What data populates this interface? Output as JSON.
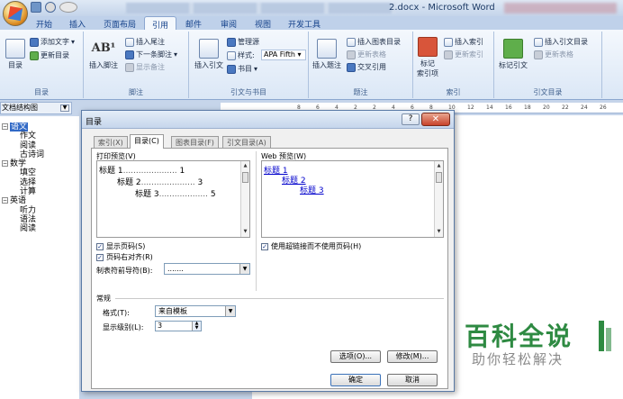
{
  "window": {
    "title": "2.docx - Microsoft Word"
  },
  "ribbon": {
    "tabs": [
      "开始",
      "插入",
      "页面布局",
      "引用",
      "邮件",
      "审阅",
      "视图",
      "开发工具"
    ],
    "active_tab": "引用",
    "groups": {
      "toc": {
        "label": "目录",
        "toc_button": "目录",
        "add_text": "添加文字",
        "update_toc": "更新目录"
      },
      "footnotes": {
        "label": "脚注",
        "insert_footnote": "插入脚注",
        "insert_endnote": "插入尾注",
        "next_footnote": "下一条脚注",
        "show_notes": "显示备注"
      },
      "citations": {
        "label": "引文与书目",
        "insert_citation": "插入引文",
        "manage_sources": "管理源",
        "style_label": "样式:",
        "style_value": "APA Fifth",
        "bibliography": "书目"
      },
      "captions": {
        "label": "题注",
        "insert_caption": "插入题注",
        "insert_table_of_figures": "插入图表目录",
        "update_table": "更新表格",
        "cross_reference": "交叉引用"
      },
      "index": {
        "label": "索引",
        "mark_entry_line1": "标记",
        "mark_entry_line2": "索引项",
        "insert_index": "插入索引",
        "update_index": "更新索引"
      },
      "table_of_authorities": {
        "label": "引文目录",
        "mark_citation": "标记引文",
        "insert_toa": "插入引文目录",
        "update_table": "更新表格"
      }
    }
  },
  "nav_pane": {
    "header": "文档结构图",
    "tree": [
      {
        "label": "语文",
        "level": 1,
        "toggle": "⊟",
        "selected": true
      },
      {
        "label": "作文",
        "level": 2
      },
      {
        "label": "阅读",
        "level": 2
      },
      {
        "label": "古诗词",
        "level": 2
      },
      {
        "label": "数学",
        "level": 1,
        "toggle": "⊟"
      },
      {
        "label": "填空",
        "level": 2
      },
      {
        "label": "选择",
        "level": 2
      },
      {
        "label": "计算",
        "level": 2
      },
      {
        "label": "英语",
        "level": 1,
        "toggle": "⊟"
      },
      {
        "label": "听力",
        "level": 2
      },
      {
        "label": "语法",
        "level": 2
      },
      {
        "label": "阅读",
        "level": 2
      }
    ]
  },
  "ruler": {
    "ticks": [
      "8",
      "6",
      "4",
      "2",
      "2",
      "4",
      "6",
      "8",
      "10",
      "12",
      "14",
      "16",
      "18",
      "20",
      "22",
      "24",
      "26"
    ]
  },
  "dialog": {
    "title": "目录",
    "help": "?",
    "close": "✕",
    "tabs": [
      "索引(X)",
      "目录(C)",
      "图表目录(F)",
      "引文目录(A)"
    ],
    "active_tab": "目录(C)",
    "print_preview": {
      "label": "打印预览(V)",
      "lines": [
        {
          "text": "标题 1",
          "page": "1"
        },
        {
          "text": "标题 2",
          "page": "3"
        },
        {
          "text": "标题 3",
          "page": "5"
        }
      ]
    },
    "web_preview": {
      "label": "Web 预览(W)",
      "lines": [
        "标题 1",
        "标题 2",
        "标题 3"
      ]
    },
    "show_page_numbers": {
      "label": "显示页码(S)",
      "checked": true
    },
    "right_align_page_numbers": {
      "label": "页码右对齐(R)",
      "checked": true
    },
    "tab_leader": {
      "label": "制表符前导符(B):",
      "value": "......."
    },
    "use_hyperlinks": {
      "label": "使用超链接而不使用页码(H)",
      "checked": true
    },
    "general": {
      "label": "常规",
      "formats_label": "格式(T):",
      "formats_value": "来自模板",
      "levels_label": "显示级别(L):",
      "levels_value": "3"
    },
    "options_button": "选项(O)...",
    "modify_button": "修改(M)...",
    "ok_button": "确定",
    "cancel_button": "取消"
  },
  "watermark": {
    "title": "百科全说",
    "subtitle": "助你轻松解决"
  },
  "icons": {
    "check": "✓",
    "dropdown": "▼",
    "scroll_up": "▲",
    "scroll_down": "▼"
  }
}
